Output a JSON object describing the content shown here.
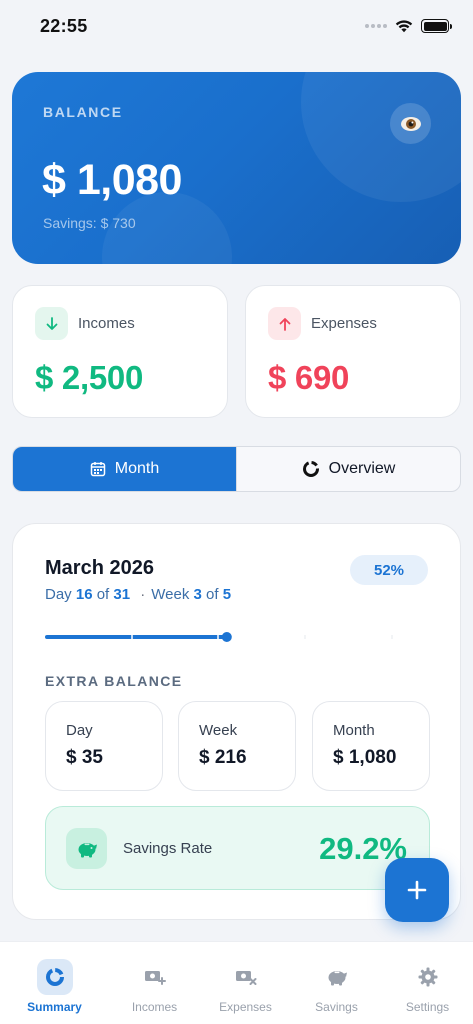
{
  "status_bar": {
    "time": "22:55"
  },
  "balance": {
    "label": "BALANCE",
    "amount": "$ 1,080",
    "savings": "Savings: $ 730"
  },
  "incomes": {
    "label": "Incomes",
    "value": "$ 2,500",
    "color": "#10b981"
  },
  "expenses": {
    "label": "Expenses",
    "value": "$ 690",
    "color": "#f0435a"
  },
  "segmented": {
    "month_label": "Month",
    "overview_label": "Overview",
    "active": "Month"
  },
  "month": {
    "title": "March 2026",
    "day_word": "Day",
    "day": "16",
    "of_word_1": "of",
    "days_total": "31",
    "separator": "·",
    "week_word": "Week",
    "week": "3",
    "of_word_2": "of",
    "weeks_total": "5",
    "progress_label": "52%",
    "progress_value": 0.52
  },
  "extra_balance": {
    "label": "EXTRA BALANCE",
    "day": {
      "label": "Day",
      "value": "$ 35"
    },
    "week": {
      "label": "Week",
      "value": "$ 216"
    },
    "month": {
      "label": "Month",
      "value": "$ 1,080"
    }
  },
  "savings_rate": {
    "label": "Savings Rate",
    "value": "29.2%"
  },
  "tabs": [
    {
      "label": "Summary",
      "icon": "summary-icon",
      "active": true
    },
    {
      "label": "Incomes",
      "icon": "incomes-icon",
      "active": false
    },
    {
      "label": "Expenses",
      "icon": "expenses-icon",
      "active": false
    },
    {
      "label": "Savings",
      "icon": "piggy-bank-icon",
      "active": false
    },
    {
      "label": "Settings",
      "icon": "gear-icon",
      "active": false
    }
  ],
  "colors": {
    "primary": "#1c74d3",
    "income": "#10b981",
    "expense": "#f0435a"
  }
}
